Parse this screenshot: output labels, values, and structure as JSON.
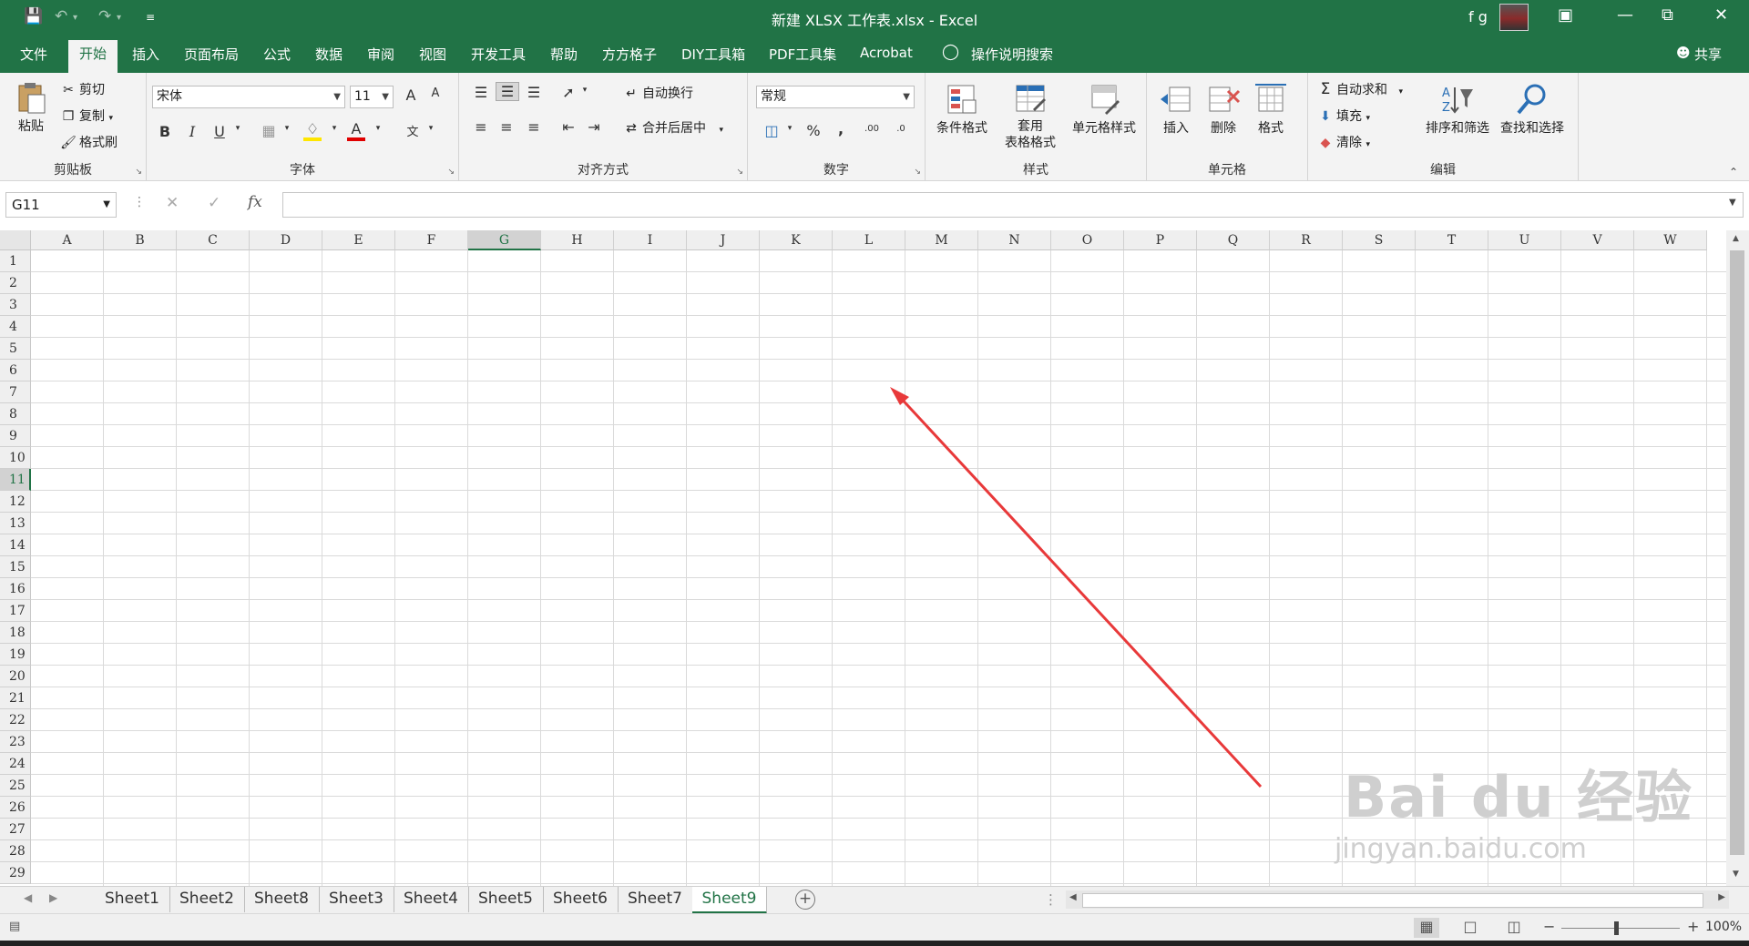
{
  "window": {
    "title": "新建 XLSX 工作表.xlsx  -  Excel",
    "user_name": "f g"
  },
  "ribbon_tabs": [
    "文件",
    "开始",
    "插入",
    "页面布局",
    "公式",
    "数据",
    "审阅",
    "视图",
    "开发工具",
    "帮助",
    "方方格子",
    "DIY工具箱",
    "PDF工具集",
    "Acrobat"
  ],
  "active_tab": "开始",
  "tell_me": "操作说明搜索",
  "share_label": "共享",
  "clipboard": {
    "paste": "粘贴",
    "cut": "剪切",
    "copy": "复制",
    "format_painter": "格式刷",
    "group_label": "剪贴板"
  },
  "font": {
    "name": "宋体",
    "size": "11",
    "bold": "B",
    "italic": "I",
    "underline": "U",
    "grow": "A",
    "shrink": "A",
    "font_color_letter": "A",
    "phonetic": "文",
    "group_label": "字体"
  },
  "alignment": {
    "wrap_text": "自动换行",
    "merge_center": "合并后居中",
    "group_label": "对齐方式"
  },
  "number": {
    "format": "常规",
    "percent": "%",
    "comma": ",",
    "inc_decimal": ".00",
    "dec_decimal": ".0",
    "group_label": "数字"
  },
  "styles": {
    "conditional": "条件格式",
    "table_line1": "套用",
    "table_line2": "表格格式",
    "cell_styles": "单元格样式",
    "group_label": "样式"
  },
  "cells_group": {
    "insert": "插入",
    "delete": "删除",
    "format": "格式",
    "group_label": "单元格"
  },
  "editing": {
    "autosum": "自动求和",
    "fill": "填充",
    "clear": "清除",
    "sort_filter": "排序和筛选",
    "find_select": "查找和选择",
    "group_label": "编辑"
  },
  "formula_bar": {
    "name_box": "G11",
    "fx": "fx",
    "value": ""
  },
  "columns": [
    "A",
    "B",
    "C",
    "D",
    "E",
    "F",
    "G",
    "H",
    "I",
    "J",
    "K",
    "L",
    "M",
    "N",
    "O",
    "P",
    "Q",
    "R",
    "S",
    "T",
    "U",
    "V",
    "W"
  ],
  "rows": [
    "1",
    "2",
    "3",
    "4",
    "5",
    "6",
    "7",
    "8",
    "9",
    "10",
    "11",
    "12",
    "13",
    "14",
    "15",
    "16",
    "17",
    "18",
    "19",
    "20",
    "21",
    "22",
    "23",
    "24",
    "25",
    "26",
    "27",
    "28",
    "29"
  ],
  "selected_cell": {
    "column": "G",
    "row": "11"
  },
  "sheets": [
    "Sheet1",
    "Sheet2",
    "Sheet8",
    "Sheet3",
    "Sheet4",
    "Sheet5",
    "Sheet6",
    "Sheet7",
    "Sheet9"
  ],
  "active_sheet": "Sheet9",
  "status": {
    "zoom": "100%",
    "zoom_minus": "−",
    "zoom_plus": "+"
  },
  "annotation_color": "#e8393a",
  "accent_color": "#217346",
  "watermark": {
    "line1": "Bai du 经验",
    "line2": "jingyan.baidu.com"
  }
}
